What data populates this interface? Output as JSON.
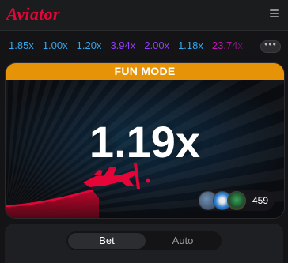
{
  "header": {
    "logo": "Aviator",
    "menu_icon": "hamburger-menu-icon"
  },
  "history": {
    "items": [
      {
        "value": "1.85x",
        "color": "#35a8f2"
      },
      {
        "value": "1.00x",
        "color": "#35a8f2"
      },
      {
        "value": "1.20x",
        "color": "#35a8f2"
      },
      {
        "value": "3.94x",
        "color": "#913ef8"
      },
      {
        "value": "2.00x",
        "color": "#913ef8"
      },
      {
        "value": "1.18x",
        "color": "#35a8f2"
      },
      {
        "value": "23.74x",
        "color": "#c017b4"
      }
    ],
    "more_label": "•••"
  },
  "game": {
    "mode_banner": "FUN MODE",
    "multiplier": "1.19x",
    "players_count": "459",
    "plane_color": "#e50539"
  },
  "bet_panel": {
    "tabs": [
      {
        "label": "Bet",
        "active": true
      },
      {
        "label": "Auto",
        "active": false
      }
    ]
  }
}
